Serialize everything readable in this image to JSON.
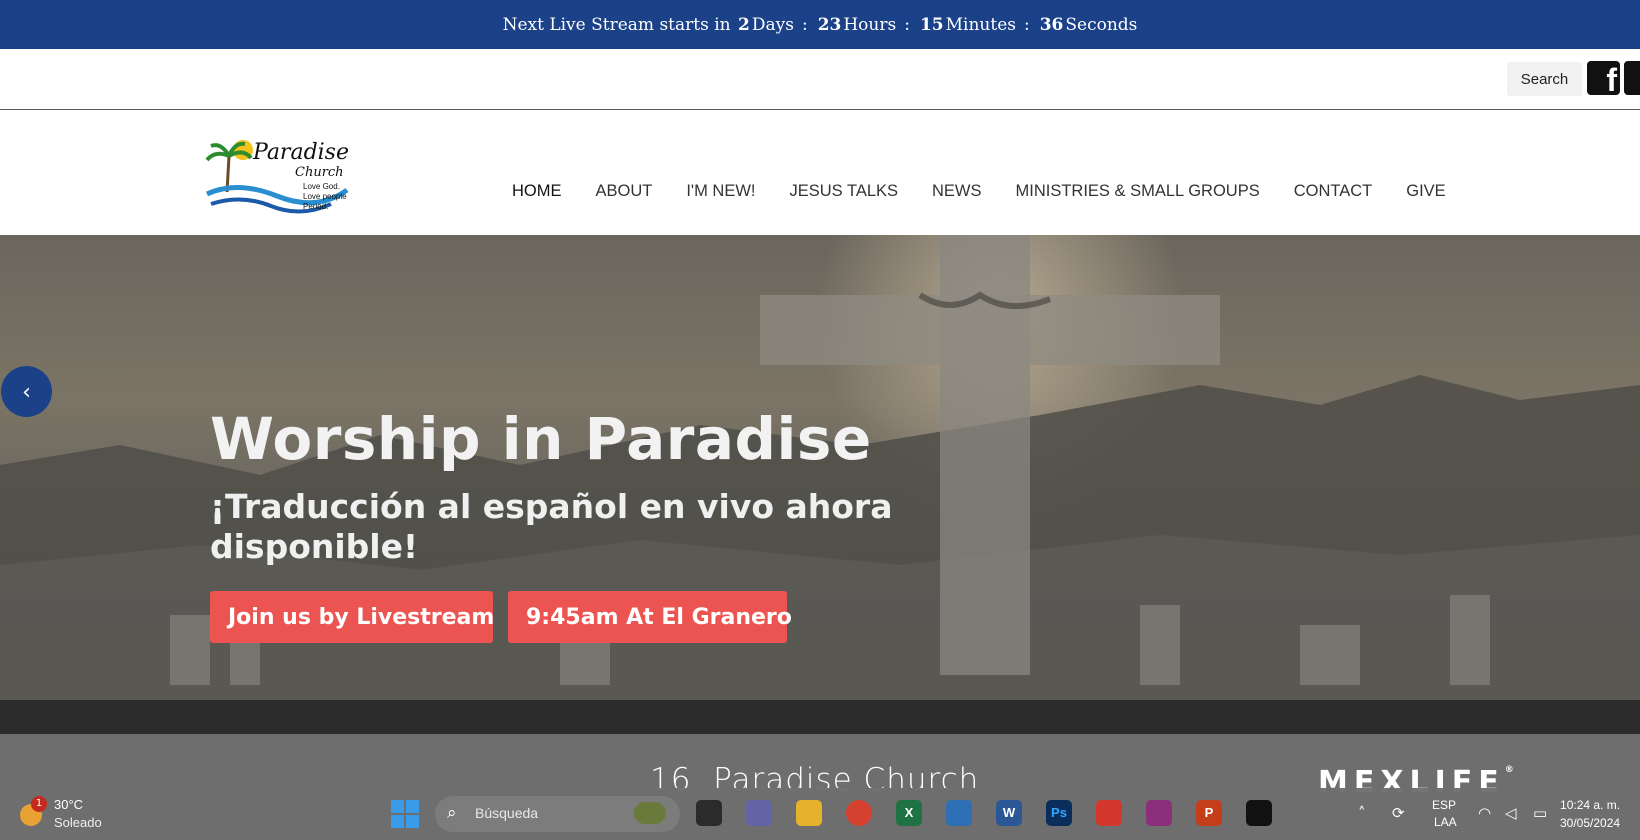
{
  "countdown": {
    "prefix": "Next Live Stream starts in",
    "days": "2",
    "days_label": "Days",
    "hours": "23",
    "hours_label": "Hours",
    "minutes": "15",
    "minutes_label": "Minutes",
    "seconds": "36",
    "seconds_label": "Seconds",
    "separator": ":"
  },
  "toolbar": {
    "search_label": "Search",
    "facebook_glyph": "f"
  },
  "logo": {
    "name": "Paradise",
    "sub": "Church",
    "tagline": "Love God.\nLove people\nPeriod."
  },
  "nav": {
    "items": [
      {
        "label": "HOME"
      },
      {
        "label": "ABOUT"
      },
      {
        "label": "I'M NEW!"
      },
      {
        "label": "JESUS TALKS"
      },
      {
        "label": "NEWS"
      },
      {
        "label": "MINISTRIES & SMALL GROUPS"
      },
      {
        "label": "CONTACT"
      },
      {
        "label": "GIVE"
      }
    ]
  },
  "hero": {
    "title": "Worship in Paradise",
    "subtitle": "¡Traducción al español en vivo ahora disponible!",
    "buttons": [
      {
        "label": "Join us by Livestream"
      },
      {
        "label": "9:45am At El Granero"
      }
    ],
    "prev_glyph": "‹"
  },
  "video_overlay": {
    "caption": "16. Paradise Church",
    "brand": "MEXLIFE",
    "brand_mark": "®"
  },
  "taskbar": {
    "weather_temp": "30°C",
    "weather_condition": "Soleado",
    "weather_badge": "1",
    "search_placeholder": "Búsqueda",
    "apps": [
      {
        "name": "file-manager",
        "color": "#2b2b2b"
      },
      {
        "name": "teams",
        "color": "#6264a7"
      },
      {
        "name": "explorer",
        "color": "#e5b32b"
      },
      {
        "name": "chrome",
        "color": "#d6412f"
      },
      {
        "name": "excel",
        "color": "#1f7244",
        "glyph": "X"
      },
      {
        "name": "mail",
        "color": "#2f6fb5"
      },
      {
        "name": "word",
        "color": "#2b5797",
        "glyph": "W"
      },
      {
        "name": "photoshop",
        "color": "#0a2d5b",
        "glyph": "Ps"
      },
      {
        "name": "acrobat",
        "color": "#d4372b"
      },
      {
        "name": "winrar",
        "color": "#8b2f7a"
      },
      {
        "name": "powerpoint",
        "color": "#c43e1c",
        "glyph": "P"
      },
      {
        "name": "capcut",
        "color": "#111111"
      }
    ],
    "language": "ESP",
    "layout": "LAA",
    "time": "10:24 a. m.",
    "date": "30/05/2024"
  }
}
